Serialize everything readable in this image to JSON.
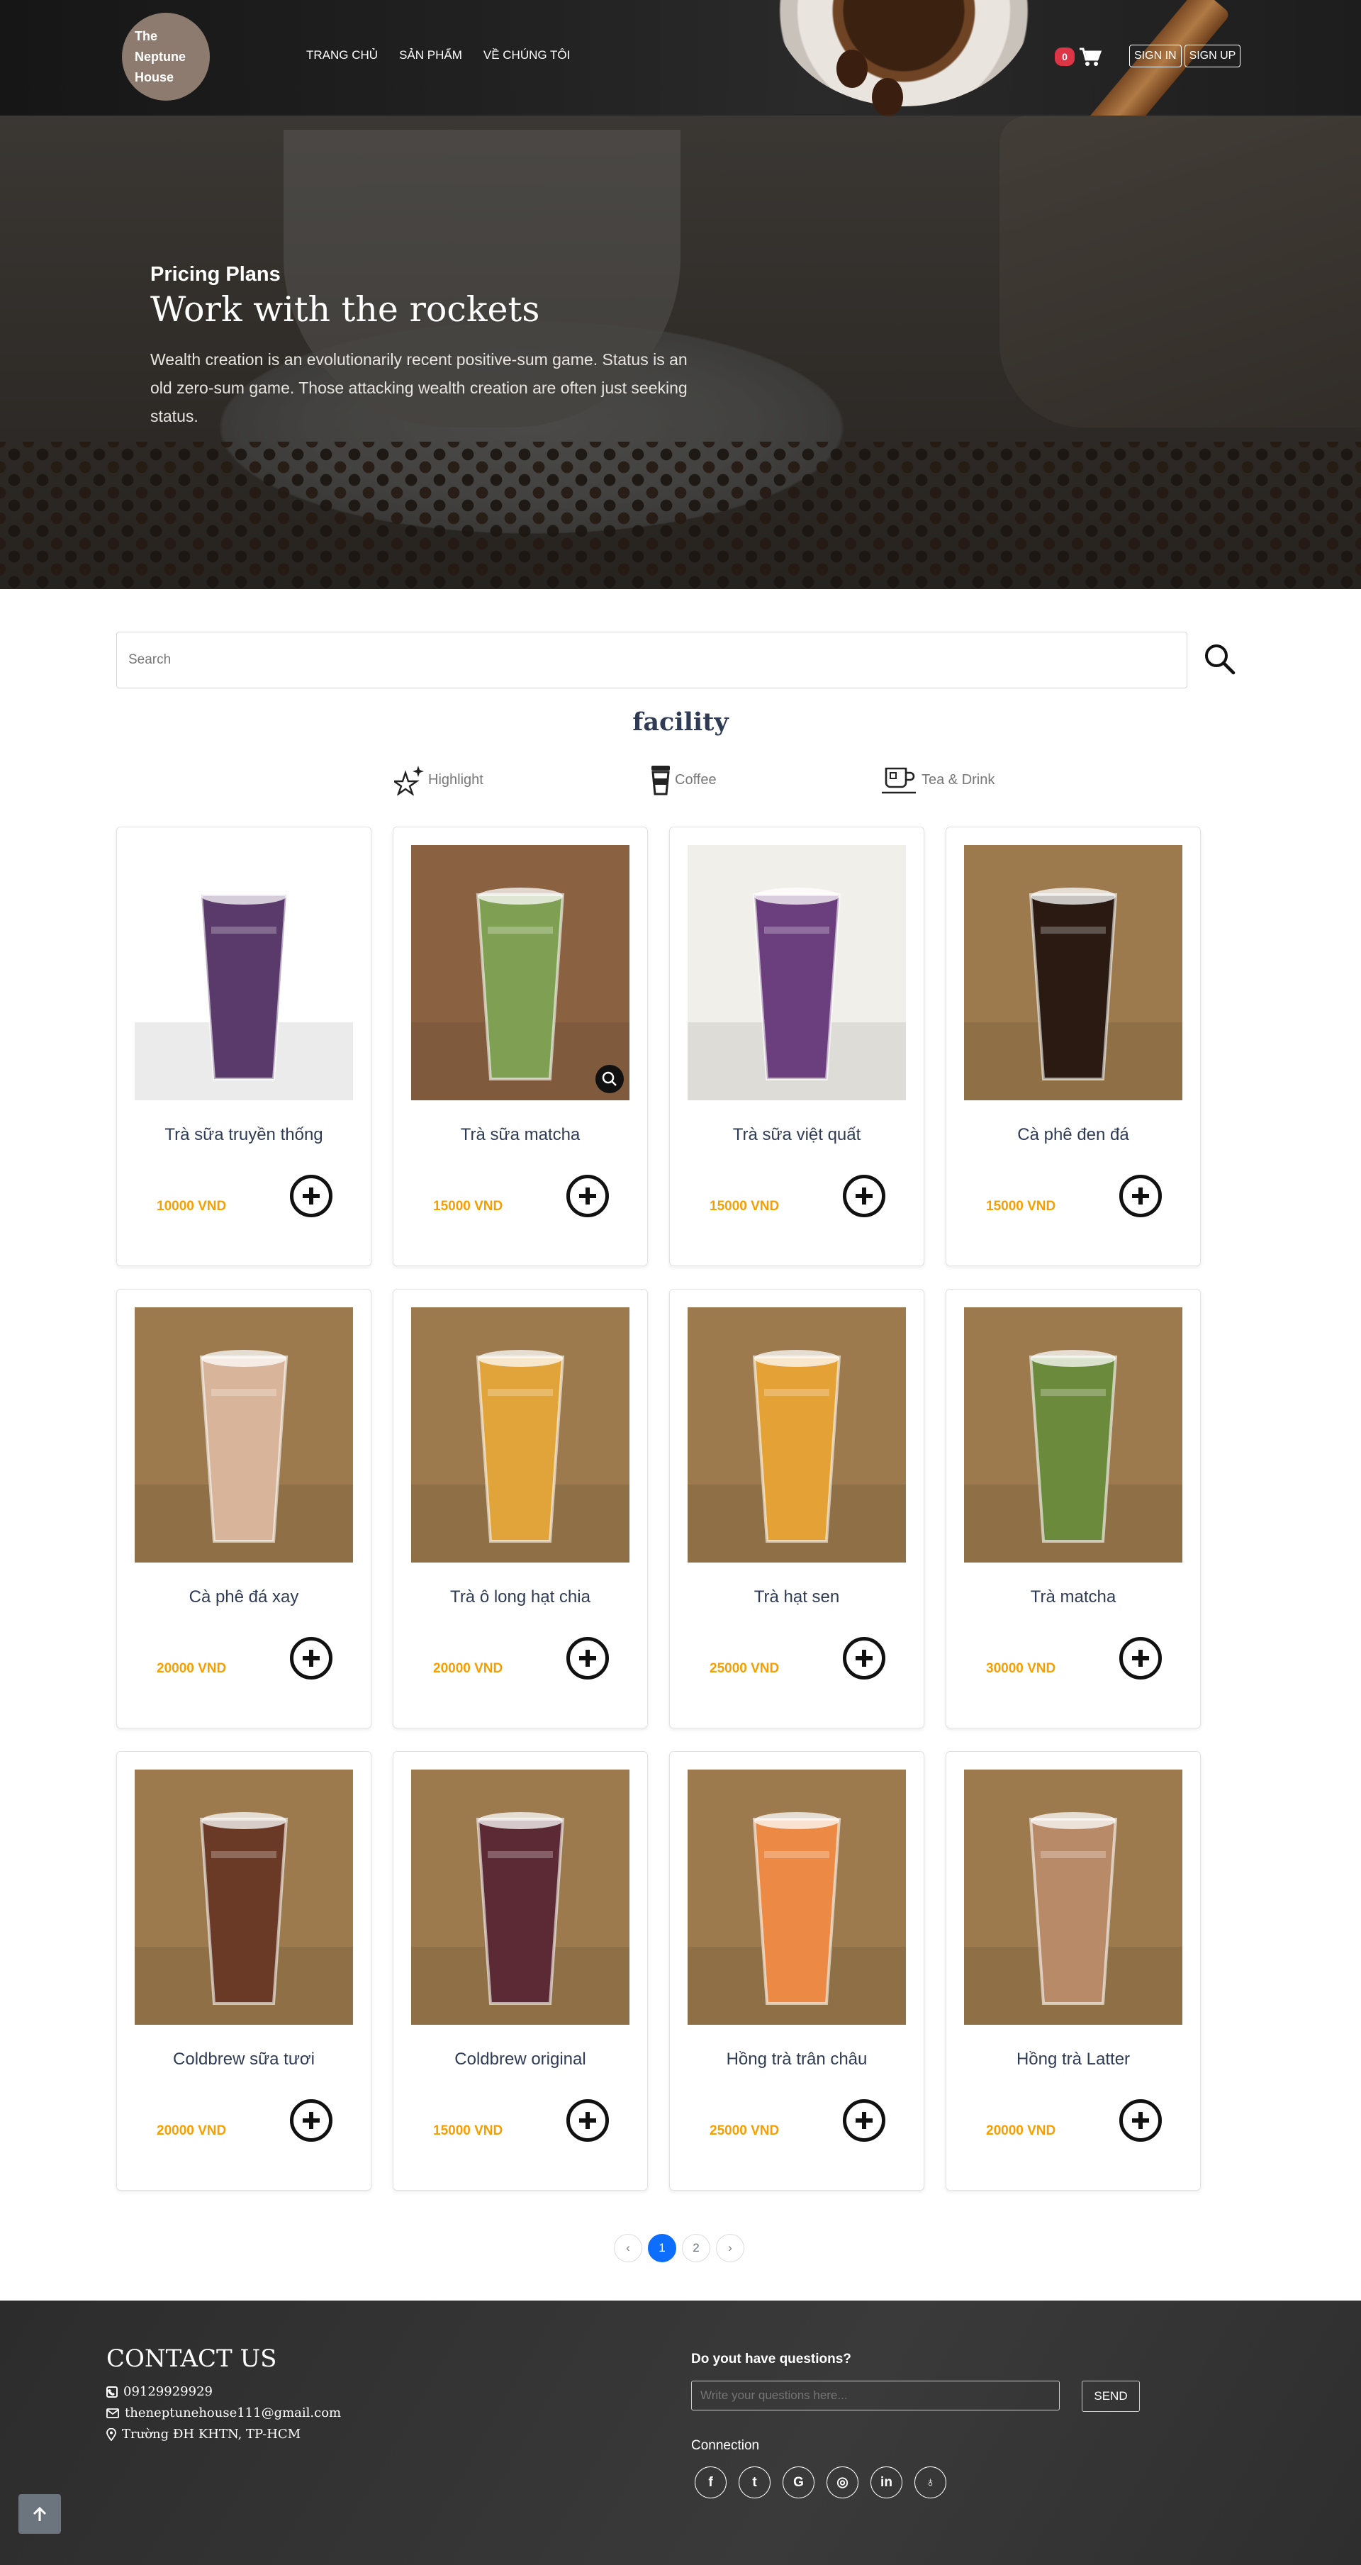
{
  "brand": {
    "logo_text": "The\nNeptune\nHouse"
  },
  "nav": {
    "items": [
      "TRANG CHỦ",
      "SẢN PHẨM",
      "VỀ CHÚNG TÔI"
    ]
  },
  "cart": {
    "count": "0",
    "icon": "cart-icon"
  },
  "auth": {
    "sign_in": "SIGN IN",
    "sign_up": "SIGN UP"
  },
  "hero": {
    "kicker": "Pricing Plans",
    "title": "Work with the rockets",
    "description": "Wealth creation is an evolutionarily recent positive-sum game. Status is an old zero-sum game. Those attacking wealth creation are often just seeking status."
  },
  "search": {
    "placeholder": "Search",
    "icon": "search-icon"
  },
  "section_title": "facility",
  "categories": [
    {
      "label": "Highlight",
      "icon": "sparkle-star-icon"
    },
    {
      "label": "Coffee",
      "icon": "coffee-cup-icon"
    },
    {
      "label": "Tea & Drink",
      "icon": "tea-mug-icon"
    }
  ],
  "products": [
    {
      "name": "Trà sữa truyền thống",
      "price": "10000 VND",
      "color": "#5a3a6b"
    },
    {
      "name": "Trà sữa matcha",
      "price": "15000 VND",
      "color": "#7fa053"
    },
    {
      "name": "Trà sữa việt quất",
      "price": "15000 VND",
      "color": "#6b3f7e"
    },
    {
      "name": "Cà phê đen đá",
      "price": "15000 VND",
      "color": "#2a1a12"
    },
    {
      "name": "Cà phê đá xay",
      "price": "20000 VND",
      "color": "#d8b59a"
    },
    {
      "name": "Trà ô long hạt chia",
      "price": "20000 VND",
      "color": "#e0a43a"
    },
    {
      "name": "Trà hạt sen",
      "price": "25000 VND",
      "color": "#e4a136"
    },
    {
      "name": "Trà matcha",
      "price": "30000 VND",
      "color": "#6c8a3c"
    },
    {
      "name": "Coldbrew sữa tươi",
      "price": "20000 VND",
      "color": "#6a3a26"
    },
    {
      "name": "Coldbrew original",
      "price": "15000 VND",
      "color": "#5c2a34"
    },
    {
      "name": "Hồng trà trân châu",
      "price": "25000 VND",
      "color": "#ec8a45"
    },
    {
      "name": "Hồng trà Latter",
      "price": "20000 VND",
      "color": "#b98a68"
    }
  ],
  "pagination": {
    "prev": "‹",
    "pages": [
      "1",
      "2"
    ],
    "active": "1",
    "next": "›"
  },
  "footer": {
    "contact_title": "CONTACT US",
    "phone": "09129929929",
    "email": "theneptunehouse111@gmail.com",
    "address": "Trường ĐH KHTN, TP-HCM",
    "question_label": "Do yout have questions?",
    "question_placeholder": "Write your questions here...",
    "send_label": "SEND",
    "connection_label": "Connection",
    "socials": [
      {
        "icon": "facebook-icon",
        "glyph": "f"
      },
      {
        "icon": "twitter-icon",
        "glyph": "t"
      },
      {
        "icon": "google-icon",
        "glyph": "G"
      },
      {
        "icon": "instagram-icon",
        "glyph": "◎"
      },
      {
        "icon": "linkedin-icon",
        "glyph": "in"
      },
      {
        "icon": "github-icon",
        "glyph": "♁"
      }
    ]
  },
  "colors": {
    "accent": "#0d6efd",
    "price": "#f59f00",
    "badge": "#dc3545",
    "heading": "#2f3b55"
  }
}
